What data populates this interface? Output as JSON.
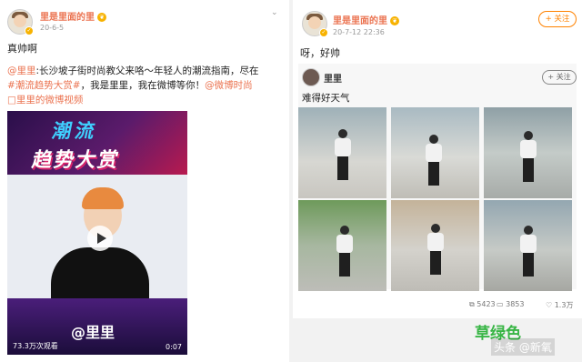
{
  "left_post": {
    "user_name": "里是里面的里",
    "rank_badge": "❦",
    "date": "20-6-5",
    "text": "真帅啊",
    "repost": {
      "author_link": "@里里",
      "line1_rest": ":长沙坡子街时尚教父来咯～年轻人的潮流指南，尽在",
      "hashtag": "#潮流趋势大赏#",
      "line2_mid": "，我是里里，我在微博等你！",
      "mention": "@微博时尚",
      "video_link_icon": "□",
      "video_link": "里里的微博视频"
    },
    "video": {
      "banner_top": "潮流",
      "banner_bottom": "趋势大赏",
      "overlay_name": "@里里",
      "views": "73.3万次观看",
      "duration": "0:07"
    }
  },
  "right_post": {
    "user_name": "里是里面的里",
    "rank_badge": "❦",
    "date": "20-7-12 22:36",
    "follow_label": "+ 关注",
    "text": "呀，好帅",
    "repost": {
      "user_name": "里里",
      "follow_label": "+ 关注",
      "text": "难得好天气"
    },
    "stats": {
      "reposts": "5423",
      "comments": "3853",
      "likes": "1.3万"
    }
  },
  "watermark": {
    "main": "草绿色",
    "sub": "头条 @新氧"
  },
  "colors": {
    "brand_orange": "#eb7350",
    "follow_orange": "#ff8200",
    "watermark_green": "#37b544"
  }
}
